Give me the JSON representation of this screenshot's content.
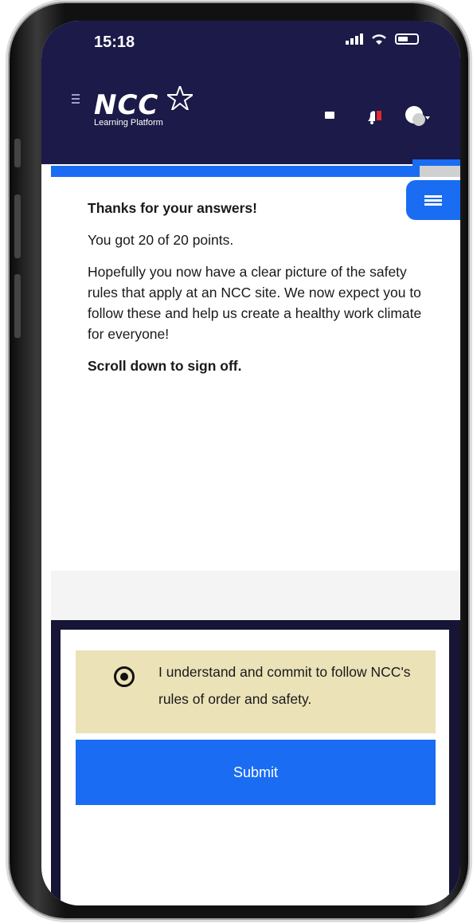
{
  "status_bar": {
    "time": "15:18",
    "icons": [
      "signal-icon",
      "wifi-icon",
      "battery-icon"
    ]
  },
  "header": {
    "logo_text": "NCC",
    "logo_subtitle": "Learning Platform",
    "icons": [
      "menu-icon",
      "mail-icon",
      "notification-bell-icon",
      "avatar-icon"
    ],
    "notification_badge_color": "#e0282f"
  },
  "progress": {
    "fraction": 0.9
  },
  "content": {
    "heading": "Thanks for your answers!",
    "score": "You got 20 of 20 points.",
    "body": "Hopefully you now have a clear picture of the safety rules that apply at an NCC site. We now expect you to follow these and help us create a healthy work climate for everyone!",
    "instruction": "Scroll down to sign off."
  },
  "commit": {
    "selected": true,
    "label": "I understand and commit to follow NCC's rules of order and safety."
  },
  "submit": {
    "label": "Submit"
  },
  "colors": {
    "header_bg": "#1b1a48",
    "accent": "#1a6cf2",
    "commit_bg": "#ebe2b8",
    "panel_bg": "#161535"
  }
}
